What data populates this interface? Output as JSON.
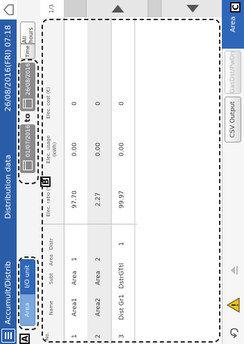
{
  "title_bar": {
    "app_title": "Accumult/Distrib",
    "page_title": "Distribution data",
    "datetime": "26/08/2016(FRI) 07:18"
  },
  "toolbar": {
    "area_label": "Area",
    "io_unit_label": "I/O unit",
    "date_from": "01/07/2016",
    "to_label": "to",
    "date_to": "26/08/2016",
    "time_label": "Time",
    "all_hours_label": "All hours"
  },
  "table": {
    "headers": {
      "no": "No.",
      "name": "Name",
      "subt": "Subt",
      "area": "Area",
      "distr": "Distr",
      "ratio": "Elec. ratio (%)",
      "usage": "Elec. usage (kWh)",
      "cost": "Elec. cost (€)"
    },
    "rows": [
      {
        "no": "1",
        "name": "Area1",
        "subt": "Area",
        "area": "1",
        "distr": "",
        "ratio": "97.70",
        "usage": "0.00",
        "cost": "0"
      },
      {
        "no": "2",
        "name": "Area2",
        "subt": "Area",
        "area": "2",
        "distr": "",
        "ratio": "2.27",
        "usage": "0.00",
        "cost": "0"
      },
      {
        "no": "3",
        "name": "Dist Gr1",
        "subt": "DstrGTtl",
        "area": "",
        "distr": "1",
        "ratio": "99.97",
        "usage": "0.00",
        "cost": "0"
      }
    ]
  },
  "pager": "1/3",
  "footer": {
    "csv_label": "CSV Output",
    "gas_label": "GasDst/PwDn",
    "area_label": "Area"
  },
  "callouts": {
    "a": "A",
    "b": "B",
    "c": "C"
  },
  "colors": {
    "title_bar": "#2a5da8",
    "accent": "#2f67b8",
    "date_button": "#8a8a8a",
    "warning": "#f2c200"
  }
}
